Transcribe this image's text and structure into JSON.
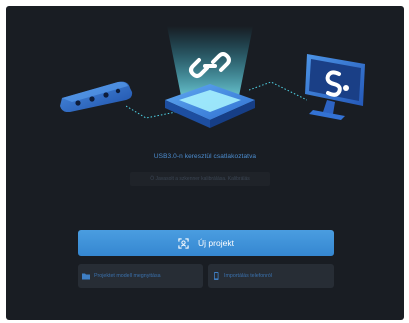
{
  "status": {
    "connection_text": "USB3.0-n keresztül csatlakoztatva",
    "hint_text": "Ö Javasolt a szkenner kalibrálása. Kalibrálás"
  },
  "actions": {
    "new_project_label": "Új projekt",
    "open_project_label": "Projektet modell megnyitása",
    "import_phone_label": "Importálás telefonról"
  },
  "colors": {
    "background": "#191d23",
    "accent": "#3f93da",
    "link": "#4d8fd3",
    "secondary_button": "#272d35"
  },
  "icons": {
    "new_project": "scan-frame-icon",
    "open_project": "folder-icon",
    "import_phone": "phone-icon",
    "hub": "link-icon",
    "monitor_logo": "app-logo-icon"
  }
}
